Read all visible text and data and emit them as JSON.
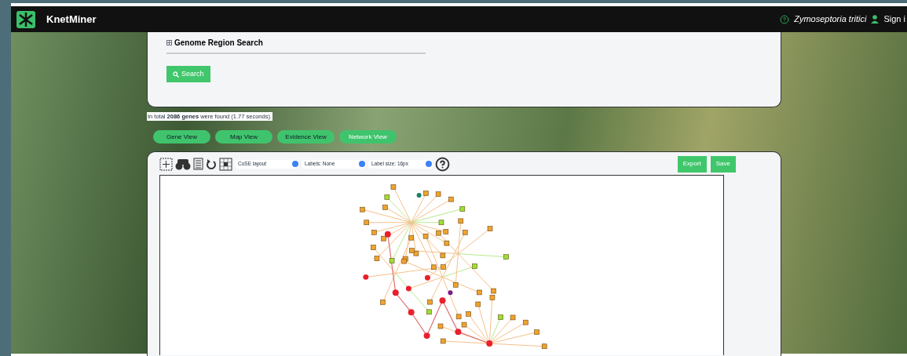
{
  "header": {
    "brand": "KnetMiner",
    "species": "Zymoseptoria tritici",
    "sign_in": "Sign i"
  },
  "search_panel": {
    "section": "Genome Region Search",
    "expanded": false,
    "search_button": "Search"
  },
  "result_summary": "In total **2086 genes** were found (1.77 seconds).",
  "tabs": [
    {
      "label": "Gene View",
      "selected": false
    },
    {
      "label": "Map View",
      "selected": false
    },
    {
      "label": "Evidence View",
      "selected": false
    },
    {
      "label": "Network View",
      "selected": true
    }
  ],
  "network_toolbar": {
    "selects": [
      "CoSE layout",
      "Labels: None",
      "Label size: 16px"
    ],
    "buttons": [
      "Export",
      "Save"
    ]
  }
}
